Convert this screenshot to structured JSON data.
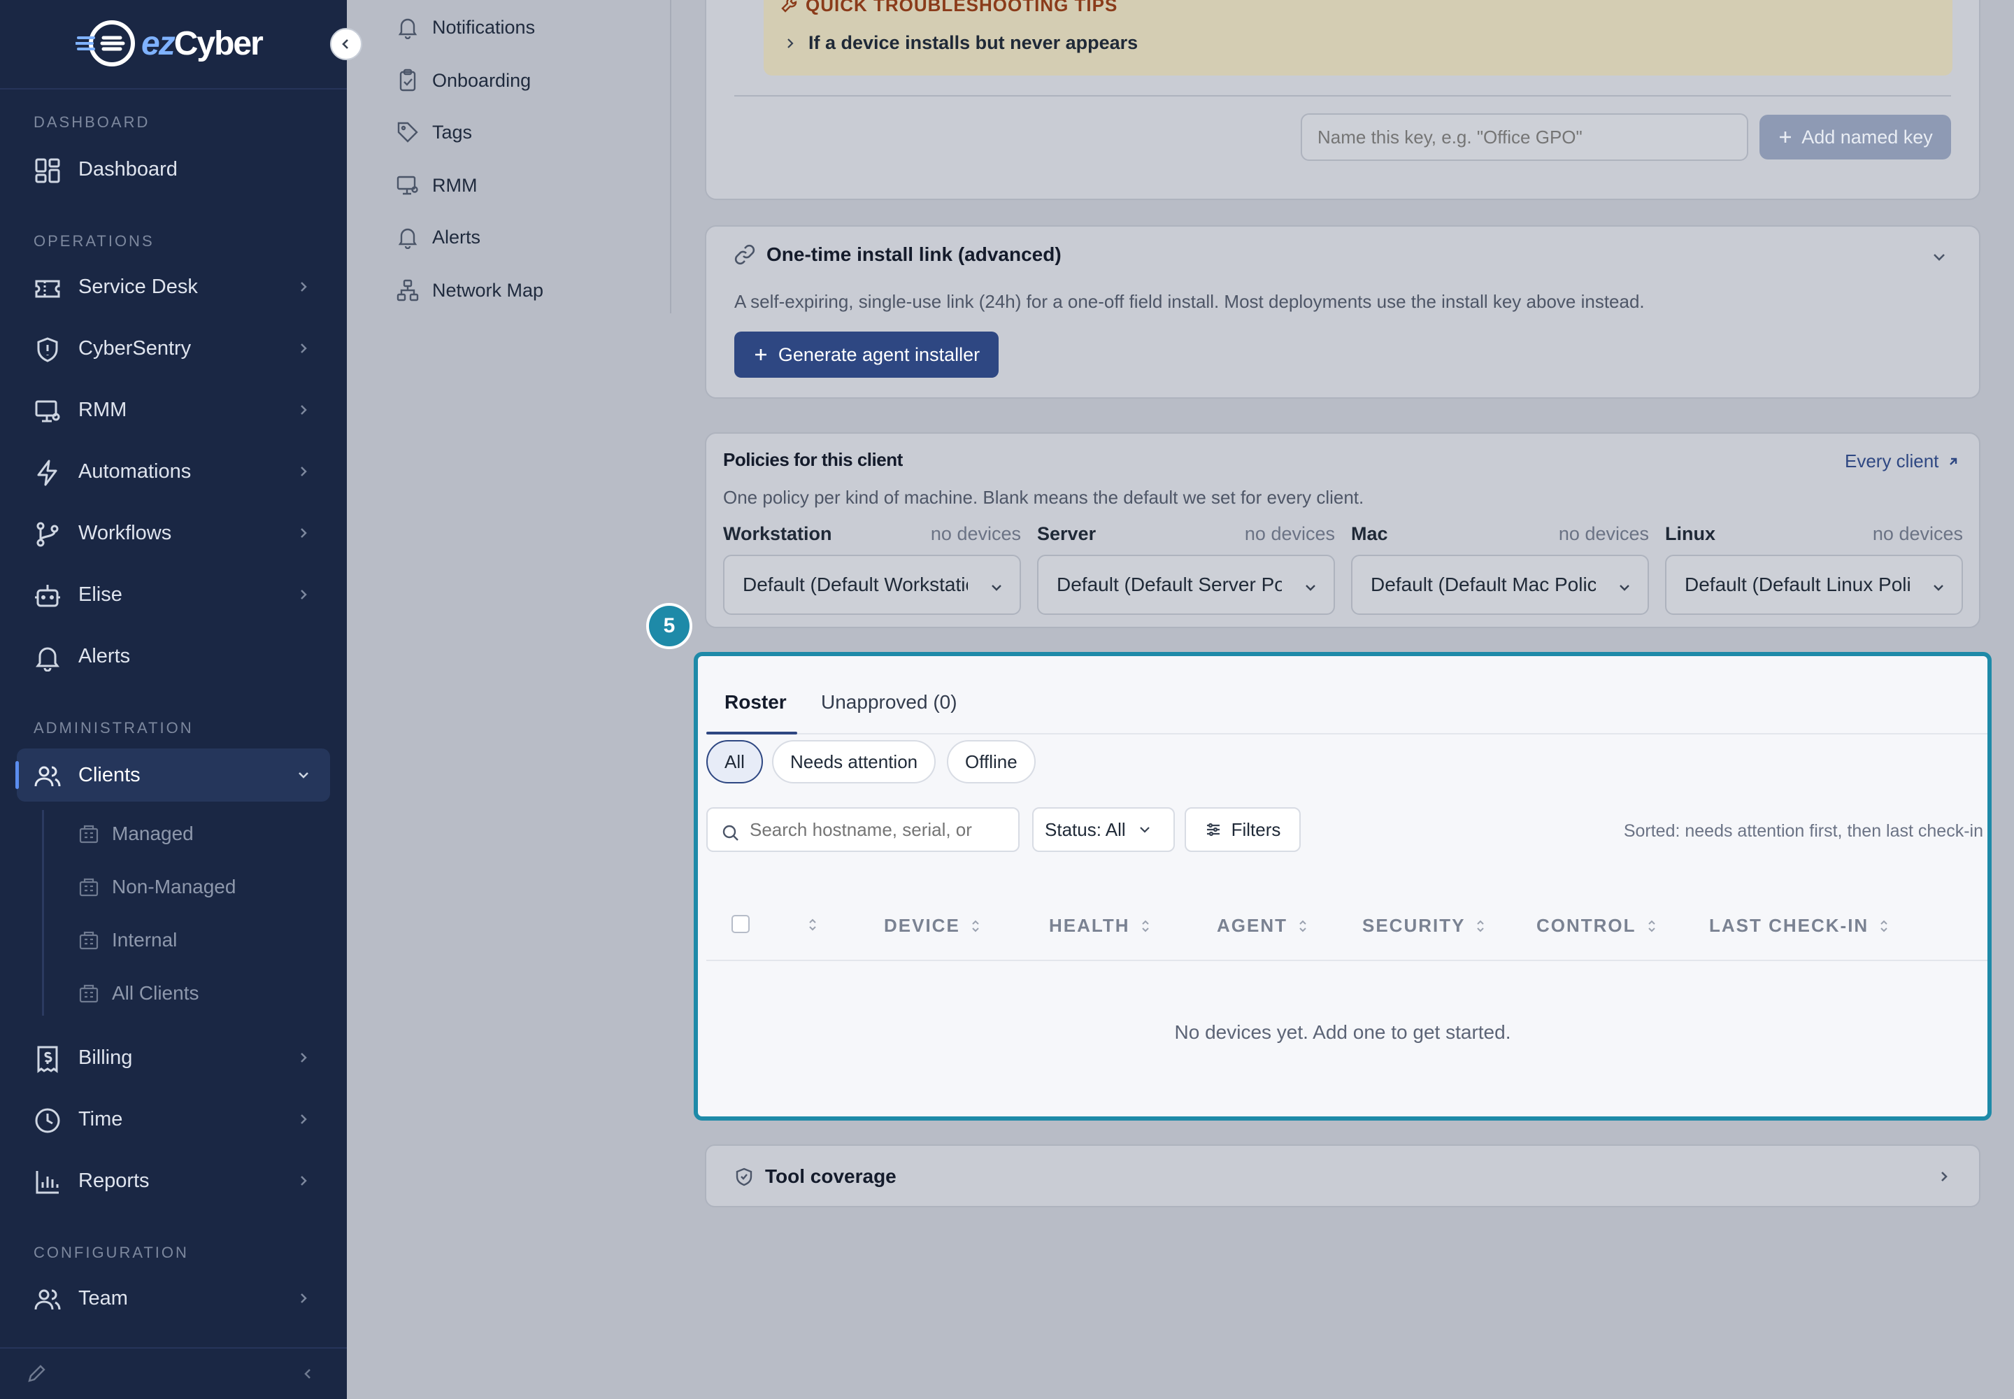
{
  "brand": {
    "logo_text_a": "ez",
    "logo_text_b": "Cyber"
  },
  "sidebar": {
    "sections": {
      "dashboard": "DASHBOARD",
      "operations": "OPERATIONS",
      "administration": "ADMINISTRATION",
      "configuration": "CONFIGURATION"
    },
    "items": [
      {
        "label": "Dashboard"
      },
      {
        "label": "Service Desk"
      },
      {
        "label": "CyberSentry"
      },
      {
        "label": "RMM"
      },
      {
        "label": "Automations"
      },
      {
        "label": "Workflows"
      },
      {
        "label": "Elise"
      },
      {
        "label": "Alerts"
      },
      {
        "label": "Clients"
      },
      {
        "label": "Billing"
      },
      {
        "label": "Time"
      },
      {
        "label": "Reports"
      },
      {
        "label": "Team"
      }
    ],
    "clients_sub": [
      {
        "label": "Managed"
      },
      {
        "label": "Non-Managed"
      },
      {
        "label": "Internal"
      },
      {
        "label": "All Clients"
      }
    ]
  },
  "secondary_menu": {
    "items": [
      {
        "label": "Notifications"
      },
      {
        "label": "Onboarding"
      },
      {
        "label": "Tags"
      },
      {
        "label": "RMM"
      },
      {
        "label": "Alerts"
      },
      {
        "label": "Network Map"
      }
    ]
  },
  "troubleshooting": {
    "title": "QUICK TROUBLESHOOTING TIPS",
    "row": "If a device installs but never appears"
  },
  "named_key": {
    "placeholder": "Name this key, e.g. \"Office GPO\"",
    "button": "Add named key"
  },
  "install_link": {
    "title": "One-time install link (advanced)",
    "description": "A self-expiring, single-use link (24h) for a one-off field install. Most deployments use the install key above instead.",
    "button": "Generate agent installer"
  },
  "policies": {
    "title": "Policies for this client",
    "link": "Every client",
    "description": "One policy per kind of machine. Blank means the default we set for every client.",
    "columns": [
      {
        "label": "Workstation",
        "count": "no devices",
        "value": "Default (Default Workstation Policy)"
      },
      {
        "label": "Server",
        "count": "no devices",
        "value": "Default (Default Server Policy)"
      },
      {
        "label": "Mac",
        "count": "no devices",
        "value": "Default (Default Mac Policy)"
      },
      {
        "label": "Linux",
        "count": "no devices",
        "value": "Default (Default Linux Policy)"
      }
    ]
  },
  "step_badge": "5",
  "roster": {
    "tabs": [
      {
        "label": "Roster"
      },
      {
        "label": "Unapproved (0)"
      }
    ],
    "chips": [
      {
        "label": "All"
      },
      {
        "label": "Needs attention"
      },
      {
        "label": "Offline"
      }
    ],
    "search_placeholder": "Search hostname, serial, or",
    "status_filter": "Status: All",
    "filters_label": "Filters",
    "sorted_text": "Sorted: needs attention first, then last check-in",
    "columns": [
      "DEVICE",
      "HEALTH",
      "AGENT",
      "SECURITY",
      "CONTROL",
      "LAST CHECK-IN"
    ],
    "empty_message": "No devices yet. Add one to get started."
  },
  "tool_coverage": {
    "title": "Tool coverage"
  },
  "colors": {
    "sidebar_bg": "#1a2744",
    "accent_teal": "#1e8aa8",
    "primary": "#2e4782",
    "tips_title": "#8a3b1a"
  }
}
